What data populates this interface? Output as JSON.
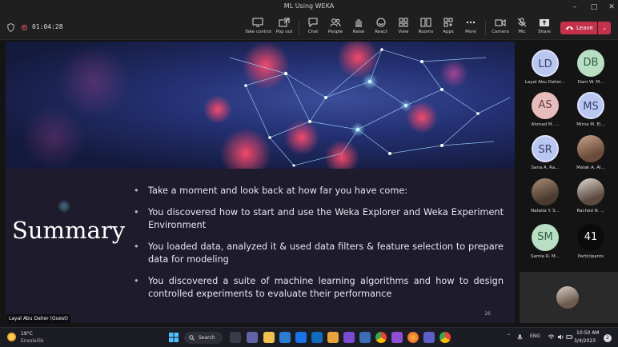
{
  "window": {
    "title": "ML Using WEKA"
  },
  "meeting": {
    "timer": "01:04:28",
    "buttons": [
      {
        "id": "take-control",
        "label": "Take control"
      },
      {
        "id": "pop-out",
        "label": "Pop out"
      },
      {
        "id": "chat",
        "label": "Chat"
      },
      {
        "id": "people",
        "label": "People"
      },
      {
        "id": "raise",
        "label": "Raise"
      },
      {
        "id": "react",
        "label": "React"
      },
      {
        "id": "view",
        "label": "View"
      },
      {
        "id": "rooms",
        "label": "Rooms"
      },
      {
        "id": "apps",
        "label": "Apps"
      },
      {
        "id": "more",
        "label": "More"
      },
      {
        "id": "camera",
        "label": "Camera"
      },
      {
        "id": "mic",
        "label": "Mic"
      },
      {
        "id": "share",
        "label": "Share"
      }
    ],
    "leave_label": "Leave"
  },
  "slide": {
    "title": "Summary",
    "bullets": [
      "Take a moment and look back at how far you have come:",
      "You discovered how to start and use the Weka Explorer and Weka Experiment Environment",
      "You loaded data, analyzed it & used data filters & feature selection to prepare data for modeling",
      "You discovered a suite of machine learning algorithms and how to design controlled experiments to evaluate their performance"
    ],
    "page_number": "26",
    "speaker_label": "Layal Abu Daher (Guest)"
  },
  "participants": [
    {
      "initials": "LD",
      "name": "Layal Abu Daher...",
      "style": "av-blue"
    },
    {
      "initials": "DB",
      "name": "Dani W. M...",
      "style": "av-green"
    },
    {
      "initials": "AS",
      "name": "Ahmad M. ...",
      "style": "av-pink"
    },
    {
      "initials": "MS",
      "name": "Mirna M. El...",
      "style": "av-blue"
    },
    {
      "initials": "SR",
      "name": "Sana A. Ra...",
      "style": "av-blue"
    },
    {
      "initials": "",
      "name": "Malak A. Al...",
      "style": "av-photo"
    },
    {
      "initials": "",
      "name": "Natalia Y. S...",
      "style": "av-photo2"
    },
    {
      "initials": "",
      "name": "Rached N. ...",
      "style": "av-photo3"
    },
    {
      "initials": "SM",
      "name": "Samia R. M...",
      "style": "av-green"
    },
    {
      "initials": "41",
      "name": "Participants",
      "style": "av-dark"
    }
  ],
  "taskbar": {
    "weather_temp": "19°C",
    "weather_desc": "Ensoleillé",
    "search_label": "Search",
    "language": "ENG",
    "time": "10:50 AM",
    "date": "3/4/2023",
    "notifications": "2"
  },
  "colors": {
    "leave": "#c4314b",
    "slide_bg": "#1e1c2c",
    "accent": "#b9c6ef"
  }
}
